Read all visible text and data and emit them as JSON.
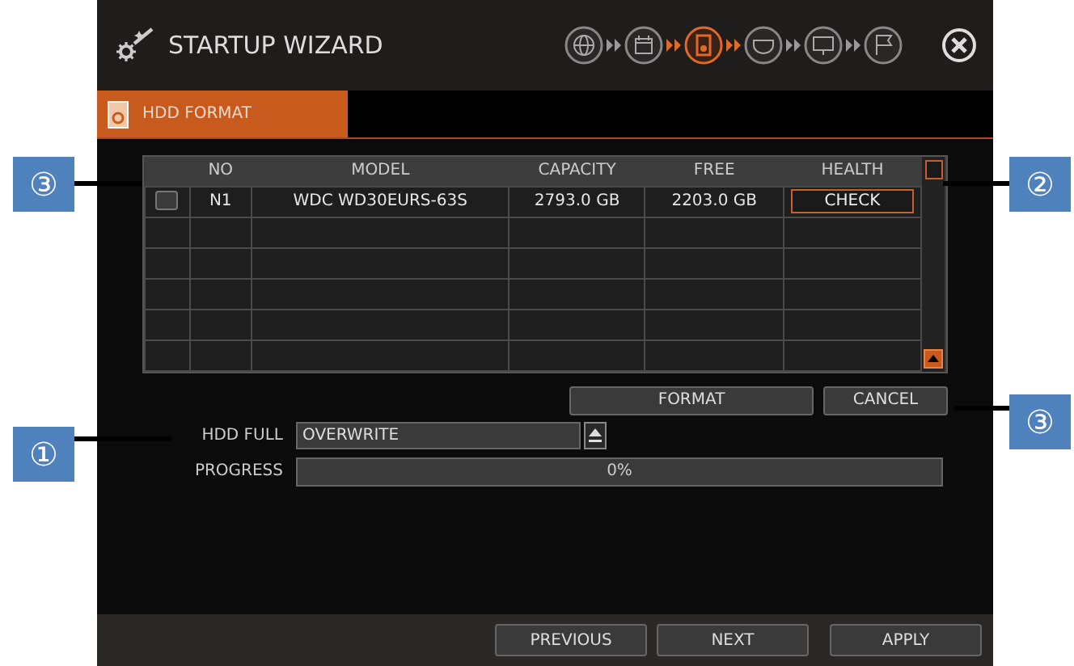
{
  "window": {
    "title": "STARTUP WIZARD"
  },
  "steps": [
    {
      "kind": "network",
      "selected": false
    },
    {
      "kind": "date",
      "selected": false
    },
    {
      "kind": "disk",
      "selected": true
    },
    {
      "kind": "camera",
      "selected": false
    },
    {
      "kind": "display",
      "selected": false
    },
    {
      "kind": "finish",
      "selected": false
    }
  ],
  "tabs": [
    {
      "label": "HDD FORMAT",
      "selected": true
    }
  ],
  "table": {
    "columns": [
      "NO",
      "MODEL",
      "CAPACITY",
      "FREE",
      "HEALTH"
    ],
    "rows": [
      {
        "checked": false,
        "cells": [
          "N1",
          "WDC WD30EURS-63S",
          "2793.0 GB",
          "2203.0 GB"
        ],
        "health_button": "CHECK"
      }
    ]
  },
  "actions": [
    {
      "label": "FORMAT"
    },
    {
      "label": "CANCEL"
    }
  ],
  "hdd_full": {
    "label": "HDD FULL",
    "value": "OVERWRITE"
  },
  "progress": {
    "label": "PROGRESS",
    "text": "0%",
    "level": 0
  },
  "footer_buttons": [
    {
      "label": "PREVIOUS"
    },
    {
      "label": "NEXT"
    },
    {
      "label": "APPLY"
    }
  ],
  "callouts": [
    {
      "text": "③"
    },
    {
      "text": "②"
    },
    {
      "text": "③"
    },
    {
      "text": "①"
    }
  ]
}
